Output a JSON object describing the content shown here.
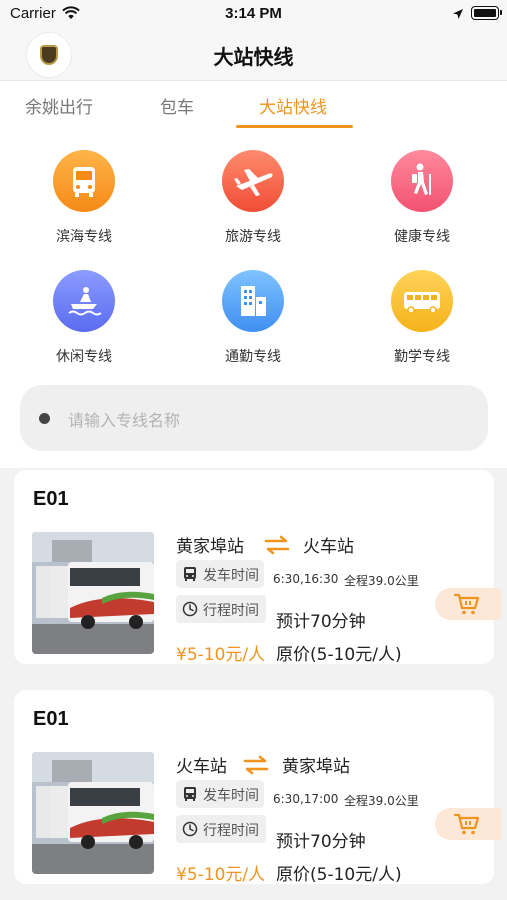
{
  "status_bar": {
    "carrier": "Carrier",
    "time": "3:14 PM"
  },
  "header": {
    "title": "大站快线"
  },
  "tabs": [
    {
      "label": "余姚出行",
      "active": false
    },
    {
      "label": "包车",
      "active": false
    },
    {
      "label": "大站快线",
      "active": true
    }
  ],
  "categories": [
    {
      "label": "滨海专线",
      "icon": "bus-icon",
      "color": "#f7a12c"
    },
    {
      "label": "旅游专线",
      "icon": "airplane-icon",
      "color": "#f4603f"
    },
    {
      "label": "健康专线",
      "icon": "hiking-icon",
      "color": "#f46582"
    },
    {
      "label": "休闲专线",
      "icon": "jet-ski-icon",
      "color": "#6c7ef5"
    },
    {
      "label": "通勤专线",
      "icon": "building-icon",
      "color": "#4f9cf5"
    },
    {
      "label": "勤学专线",
      "icon": "school-bus-icon",
      "color": "#f8c232"
    }
  ],
  "search": {
    "placeholder": "请输入专线名称"
  },
  "routes": [
    {
      "code": "E01",
      "from": "黄家埠站",
      "to": "火车站",
      "depart_label": "发车时间",
      "depart_times": "6:30,16:30",
      "distance": "全程39.0公里",
      "duration_label": "行程时间",
      "duration": "预计70分钟",
      "price": "¥5-10元/人",
      "original_price": "原价(5-10元/人)"
    },
    {
      "code": "E01",
      "from": "火车站",
      "to": "黄家埠站",
      "depart_label": "发车时间",
      "depart_times": "6:30,17:00",
      "distance": "全程39.0公里",
      "duration_label": "行程时间",
      "duration": "预计70分钟",
      "price": "¥5-10元/人",
      "original_price": "原价(5-10元/人)"
    }
  ],
  "colors": {
    "accent": "#f0941f",
    "background": "#f2f2f2"
  }
}
